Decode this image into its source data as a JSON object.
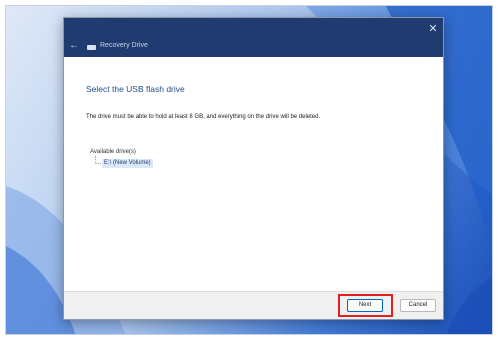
{
  "window": {
    "title": "Recovery Drive",
    "back_icon": "back-arrow-icon",
    "close_icon": "close-icon",
    "close_glyph": "✕",
    "back_glyph": "←"
  },
  "page": {
    "heading": "Select the USB flash drive",
    "description": "The drive must be able to hold at least 8 GB, and everything on the drive will be deleted.",
    "drives_label": "Available drive(s)",
    "drives": [
      {
        "label": "E:\\ (New Volume)",
        "selected": true
      }
    ]
  },
  "footer": {
    "next_label": "Next",
    "cancel_label": "Cancel"
  },
  "colors": {
    "titlebar": "#1f3b70",
    "heading": "#1f4e8c",
    "highlight": "#e02020"
  }
}
